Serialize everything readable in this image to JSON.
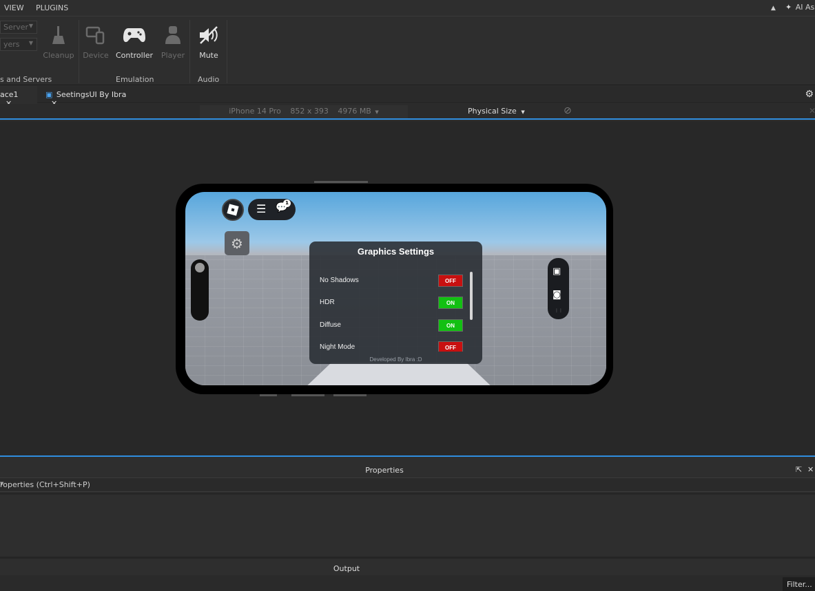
{
  "menu": {
    "view_label": "VIEW",
    "plugins_label": "PLUGINS",
    "ai_assistant_label": "AI As"
  },
  "ribbon": {
    "server_dropdown": "Server",
    "players_dropdown": "yers",
    "cleanup_label": "Cleanup",
    "clients_servers_group": "s and Servers",
    "device_label": "Device",
    "controller_label": "Controller",
    "player_label": "Player",
    "emulation_group": "Emulation",
    "mute_label": "Mute",
    "audio_group": "Audio"
  },
  "tabs": [
    {
      "label": "ace1"
    },
    {
      "label": "SeetingsUI By Ibra"
    }
  ],
  "device_bar": {
    "device_name": "iPhone 14 Pro",
    "resolution": "852 x 393",
    "memory": "4976 MB",
    "size_mode": "Physical Size"
  },
  "game": {
    "notification_count": "1",
    "panel_title": "Graphics Settings",
    "settings": [
      {
        "label": "No Shadows",
        "state": "OFF"
      },
      {
        "label": "HDR",
        "state": "ON"
      },
      {
        "label": "Diffuse",
        "state": "ON"
      },
      {
        "label": "Night Mode",
        "state": "OFF"
      }
    ],
    "footer": "Developed By Ibra :D"
  },
  "properties": {
    "title": "Properties",
    "filter_placeholder": "roperties (Ctrl+Shift+P)"
  },
  "output": {
    "title": "Output",
    "filter_label": "Filter..."
  },
  "colors": {
    "accent": "#2f8ee0",
    "toggle_on": "#12c012",
    "toggle_off": "#c81010"
  }
}
